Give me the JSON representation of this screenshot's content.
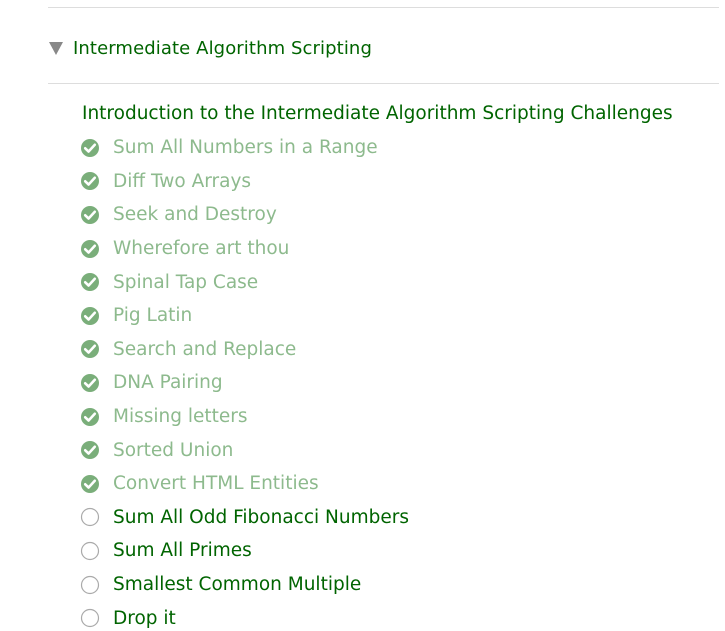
{
  "section": {
    "title": "Intermediate Algorithm Scripting",
    "expanded": true
  },
  "intro": {
    "label": "Introduction to the Intermediate Algorithm Scripting Challenges"
  },
  "colors": {
    "primary_green": "#006400",
    "completed_text": "#8dba8d",
    "check_fill": "#7aae7a",
    "caret_gray": "#888888",
    "ring_gray": "#aaaaaa",
    "divider": "#dddddd"
  },
  "challenges": [
    {
      "label": "Sum All Numbers in a Range",
      "completed": true,
      "icon": "check-circle-icon"
    },
    {
      "label": "Diff Two Arrays",
      "completed": true,
      "icon": "check-circle-icon"
    },
    {
      "label": "Seek and Destroy",
      "completed": true,
      "icon": "check-circle-icon"
    },
    {
      "label": "Wherefore art thou",
      "completed": true,
      "icon": "check-circle-icon"
    },
    {
      "label": "Spinal Tap Case",
      "completed": true,
      "icon": "check-circle-icon"
    },
    {
      "label": "Pig Latin",
      "completed": true,
      "icon": "check-circle-icon"
    },
    {
      "label": "Search and Replace",
      "completed": true,
      "icon": "check-circle-icon"
    },
    {
      "label": "DNA Pairing",
      "completed": true,
      "icon": "check-circle-icon"
    },
    {
      "label": "Missing letters",
      "completed": true,
      "icon": "check-circle-icon"
    },
    {
      "label": "Sorted Union",
      "completed": true,
      "icon": "check-circle-icon"
    },
    {
      "label": "Convert HTML Entities",
      "completed": true,
      "icon": "check-circle-icon"
    },
    {
      "label": "Sum All Odd Fibonacci Numbers",
      "completed": false,
      "icon": "empty-circle-icon"
    },
    {
      "label": "Sum All Primes",
      "completed": false,
      "icon": "empty-circle-icon"
    },
    {
      "label": "Smallest Common Multiple",
      "completed": false,
      "icon": "empty-circle-icon"
    },
    {
      "label": "Drop it",
      "completed": false,
      "icon": "empty-circle-icon"
    }
  ]
}
